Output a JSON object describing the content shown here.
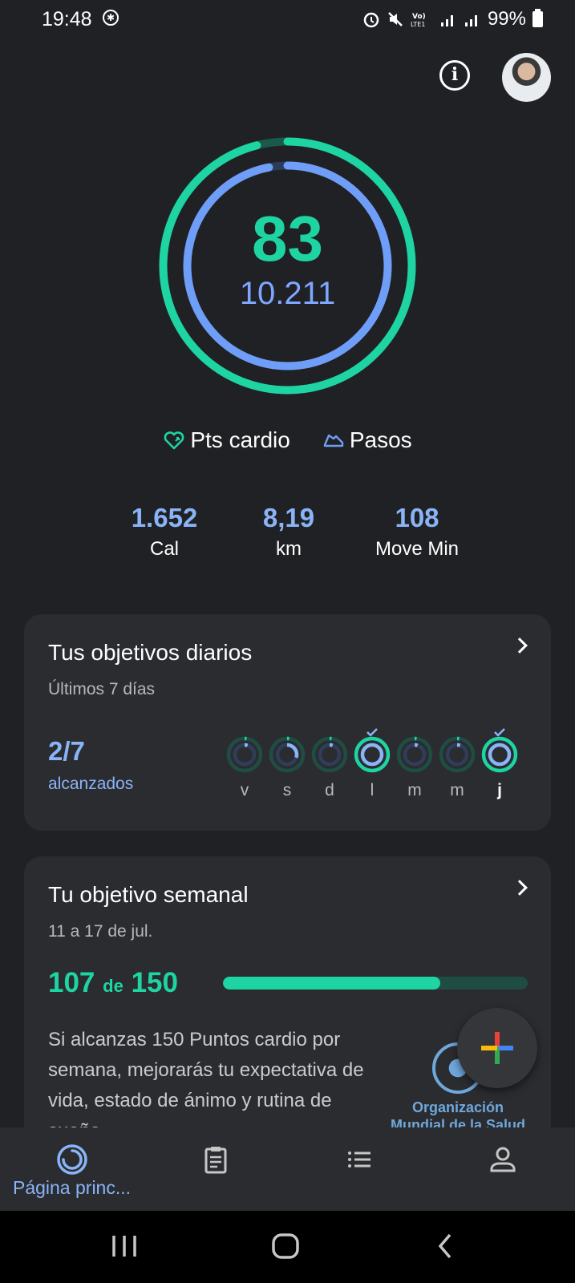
{
  "status_bar": {
    "time": "19:48",
    "battery_percent": "99%"
  },
  "header": {
    "info_icon": "info-icon",
    "avatar": "profile-avatar"
  },
  "activity_ring": {
    "cardio_points": "83",
    "steps": "10.211",
    "cardio_color": "#1ed4a3",
    "steps_color": "#6f9ef8",
    "cardio_progress": 0.96,
    "steps_progress": 0.97
  },
  "legend": {
    "cardio_label": "Pts cardio",
    "steps_label": "Pasos"
  },
  "stats": [
    {
      "value": "1.652",
      "label": "Cal"
    },
    {
      "value": "8,19",
      "label": "km"
    },
    {
      "value": "108",
      "label": "Move Min"
    }
  ],
  "daily_goals": {
    "title": "Tus objetivos diarios",
    "subtitle": "Últimos 7 días",
    "count": "2/7",
    "count_label": "alcanzados",
    "days": [
      {
        "label": "v",
        "achieved": false,
        "progress": 0.05
      },
      {
        "label": "s",
        "achieved": false,
        "progress": 0.3
      },
      {
        "label": "d",
        "achieved": false,
        "progress": 0.05
      },
      {
        "label": "l",
        "achieved": true,
        "progress": 1
      },
      {
        "label": "m",
        "achieved": false,
        "progress": 0.05
      },
      {
        "label": "m",
        "achieved": false,
        "progress": 0.05
      },
      {
        "label": "j",
        "achieved": true,
        "progress": 1,
        "today": true
      }
    ]
  },
  "weekly_goal": {
    "title": "Tu objetivo semanal",
    "subtitle": "11 a 17 de jul.",
    "current": "107",
    "of_label": "de",
    "target": "150",
    "progress": 0.713,
    "description": "Si alcanzas 150 Puntos cardio por semana, mejorarás tu expectativa de vida, estado de ánimo y rutina de sueño.",
    "org_name": "Organización Mundial de la Salud"
  },
  "bottom_nav": {
    "home_label": "Página princ..."
  }
}
